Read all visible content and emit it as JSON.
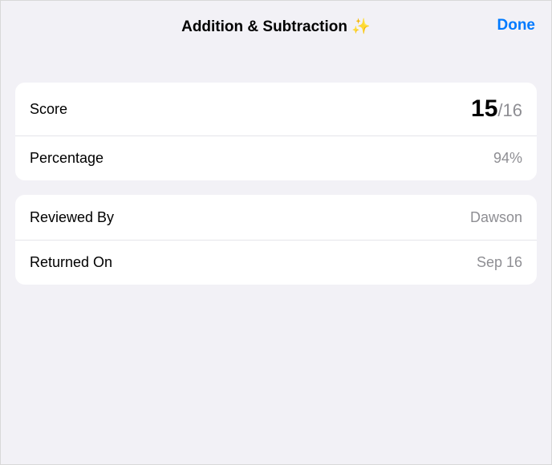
{
  "header": {
    "title": "Addition & Subtraction ✨",
    "done_label": "Done"
  },
  "score_section": {
    "score_label": "Score",
    "score_earned": "15",
    "score_divider": "/",
    "score_total": "16",
    "percentage_label": "Percentage",
    "percentage_value": "94%"
  },
  "review_section": {
    "reviewed_by_label": "Reviewed By",
    "reviewed_by_value": "Dawson",
    "returned_on_label": "Returned On",
    "returned_on_value": "Sep 16"
  }
}
